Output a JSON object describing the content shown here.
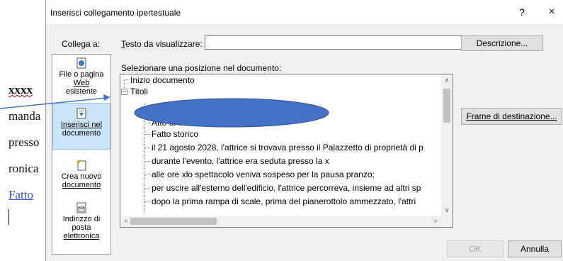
{
  "document": {
    "lines": [
      "xxxx",
      "manda",
      "presso",
      "ronica",
      "Fatto"
    ]
  },
  "dialog": {
    "title": "Inserisci collegamento ipertestuale",
    "help": "?",
    "close": "×",
    "collega_label": "Collega a:",
    "testo_label_u": "T",
    "testo_label_rest": "esto da visualizzare:",
    "testo_value": "",
    "descrizione_button": "Descrizione...",
    "seleziona_label": "Selezionare una posizione nel documento:",
    "frame_button": "Frame di destinazione...",
    "ok_button": "OK",
    "annulla_button": "Annulla"
  },
  "nav": [
    {
      "icon": "web-page-icon",
      "lines": [
        "File o pagina",
        "Web",
        "esistente"
      ]
    },
    {
      "icon": "place-in-document-icon",
      "lines": [
        "Inserisci nel",
        "documento"
      ],
      "selected": true
    },
    {
      "icon": "new-document-icon",
      "lines": [
        "Crea nuovo",
        "documento"
      ]
    },
    {
      "icon": "email-address-icon",
      "lines": [
        "Indirizzo di",
        "posta",
        "elettronica"
      ]
    }
  ],
  "tree": {
    "root_items": [
      "Inizio documento",
      "Titoli"
    ],
    "children": [
      "Atto di citazione",
      "Fatto storico",
      "il 21 agosto 2028, l'attrice si trovava presso il Palazzetto  di proprietà di p",
      "durante l'evento, l'attrice era seduta presso la x",
      "alle ore xlo spettacolo veniva sospeso per la pausa pranzo;",
      "per uscire all'esterno dell'edificio, l'attrice percorreva, insieme ad altri sp",
      "dopo la prima rampa di scale, prima del pianerottolo ammezzato, l'attri"
    ]
  },
  "colors": {
    "selection": "#cce4f7",
    "annotation": "#4472c4",
    "link": "#2e55c9"
  }
}
